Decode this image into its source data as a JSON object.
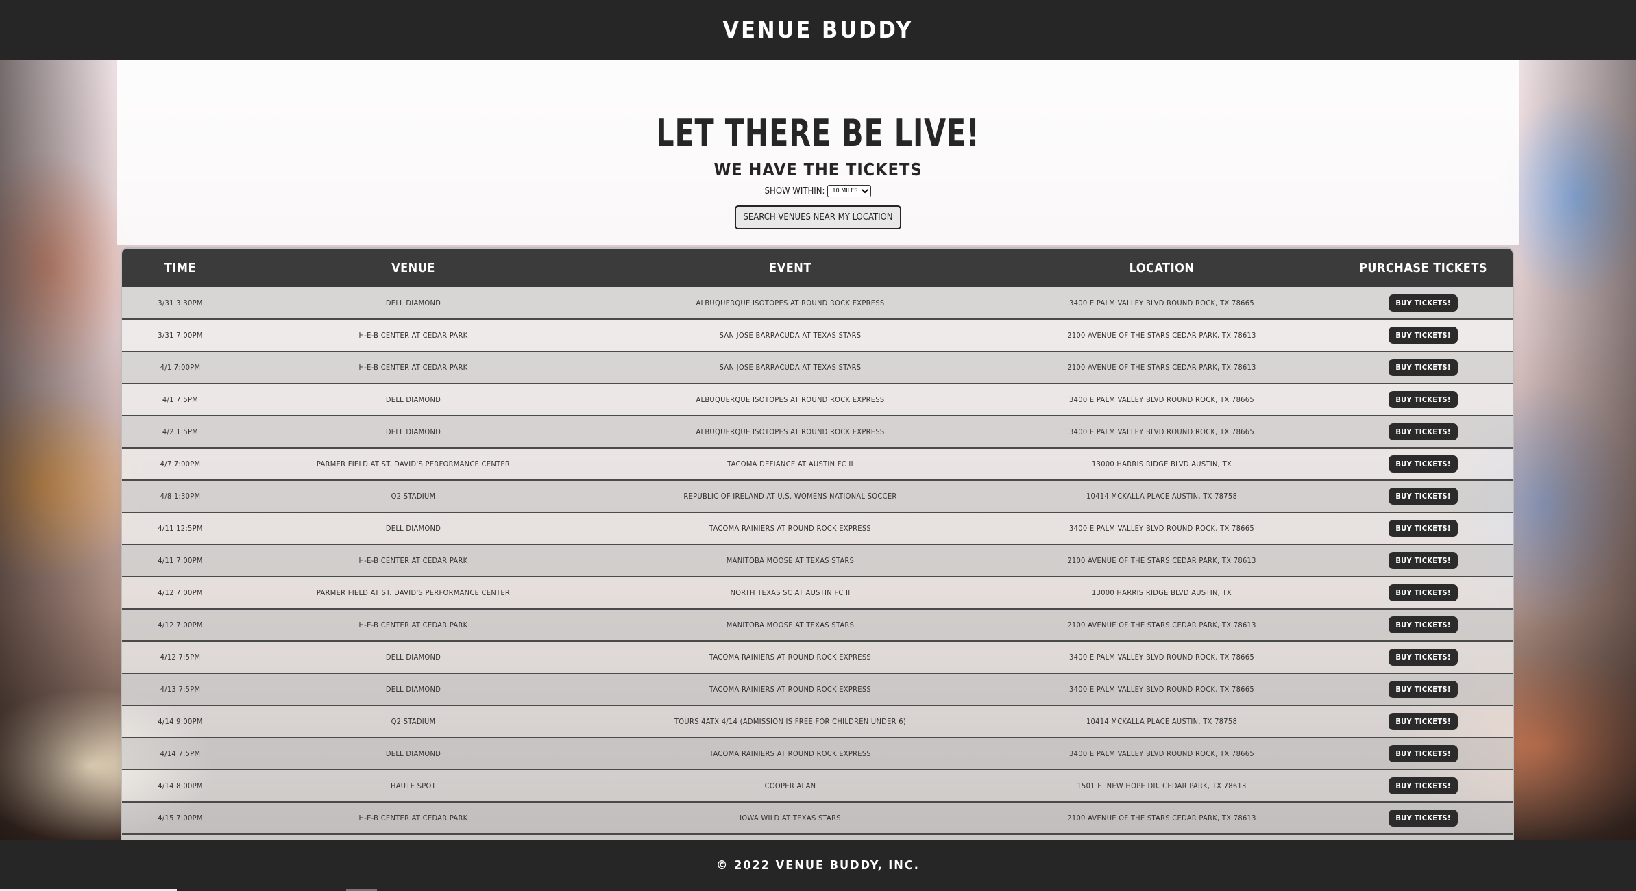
{
  "header": {
    "brand": "Venue Buddy"
  },
  "hero": {
    "title": "Let there be live!",
    "subtitle": "We have the tickets",
    "filter_label": "Show within:",
    "radius_selected": "10 miles",
    "search_button": "Search venues near my location"
  },
  "table": {
    "columns": [
      "Time",
      "Venue",
      "Event",
      "Location",
      "Purchase Tickets"
    ],
    "buy_label": "Buy Tickets!",
    "rows": [
      {
        "time": "3/31 3:30PM",
        "venue": "Dell Diamond",
        "event": "Albuquerque Isotopes at Round Rock Express",
        "location": "3400 E Palm Valley Blvd Round Rock, TX 78665"
      },
      {
        "time": "3/31 7:00PM",
        "venue": "H-E-B Center at Cedar Park",
        "event": "San Jose Barracuda at Texas Stars",
        "location": "2100 Avenue of the Stars Cedar Park, TX 78613"
      },
      {
        "time": "4/1 7:00PM",
        "venue": "H-E-B Center at Cedar Park",
        "event": "San Jose Barracuda at Texas Stars",
        "location": "2100 Avenue of the Stars Cedar Park, TX 78613"
      },
      {
        "time": "4/1 7:5PM",
        "venue": "Dell Diamond",
        "event": "Albuquerque Isotopes at Round Rock Express",
        "location": "3400 E Palm Valley Blvd Round Rock, TX 78665"
      },
      {
        "time": "4/2 1:5PM",
        "venue": "Dell Diamond",
        "event": "Albuquerque Isotopes at Round Rock Express",
        "location": "3400 E Palm Valley Blvd Round Rock, TX 78665"
      },
      {
        "time": "4/7 7:00PM",
        "venue": "Parmer Field at St. David's Performance Center",
        "event": "Tacoma Defiance at Austin FC II",
        "location": "13000 Harris Ridge Blvd Austin, TX"
      },
      {
        "time": "4/8 1:30PM",
        "venue": "Q2 Stadium",
        "event": "Republic of Ireland at U.S. Womens National Soccer",
        "location": "10414 McKalla Place Austin, TX 78758"
      },
      {
        "time": "4/11 12:5PM",
        "venue": "Dell Diamond",
        "event": "Tacoma Rainiers at Round Rock Express",
        "location": "3400 E Palm Valley Blvd Round Rock, TX 78665"
      },
      {
        "time": "4/11 7:00PM",
        "venue": "H-E-B Center at Cedar Park",
        "event": "Manitoba Moose at Texas Stars",
        "location": "2100 Avenue of the Stars Cedar Park, TX 78613"
      },
      {
        "time": "4/12 7:00PM",
        "venue": "Parmer Field at St. David's Performance Center",
        "event": "North Texas SC at Austin FC II",
        "location": "13000 Harris Ridge Blvd Austin, TX"
      },
      {
        "time": "4/12 7:00PM",
        "venue": "H-E-B Center at Cedar Park",
        "event": "Manitoba Moose at Texas Stars",
        "location": "2100 Avenue of the Stars Cedar Park, TX 78613"
      },
      {
        "time": "4/12 7:5PM",
        "venue": "Dell Diamond",
        "event": "Tacoma Rainiers at Round Rock Express",
        "location": "3400 E Palm Valley Blvd Round Rock, TX 78665"
      },
      {
        "time": "4/13 7:5PM",
        "venue": "Dell Diamond",
        "event": "Tacoma Rainiers at Round Rock Express",
        "location": "3400 E Palm Valley Blvd Round Rock, TX 78665"
      },
      {
        "time": "4/14 9:00PM",
        "venue": "Q2 Stadium",
        "event": "Tours 4ATX 4/14 (Admission is free for children under 6)",
        "location": "10414 McKalla Place Austin, TX 78758"
      },
      {
        "time": "4/14 7:5PM",
        "venue": "Dell Diamond",
        "event": "Tacoma Rainiers at Round Rock Express",
        "location": "3400 E Palm Valley Blvd Round Rock, TX 78665"
      },
      {
        "time": "4/14 8:00PM",
        "venue": "Haute Spot",
        "event": "Cooper Alan",
        "location": "1501 E. New Hope Dr. Cedar Park, TX 78613"
      },
      {
        "time": "4/15 7:00PM",
        "venue": "H-E-B Center at Cedar Park",
        "event": "Iowa Wild at Texas Stars",
        "location": "2100 Avenue of the Stars Cedar Park, TX 78613"
      },
      {
        "time": "",
        "venue": "",
        "event": "",
        "location": ""
      }
    ]
  },
  "footer": {
    "copyright": "© 2022 Venue Buddy, Inc."
  }
}
